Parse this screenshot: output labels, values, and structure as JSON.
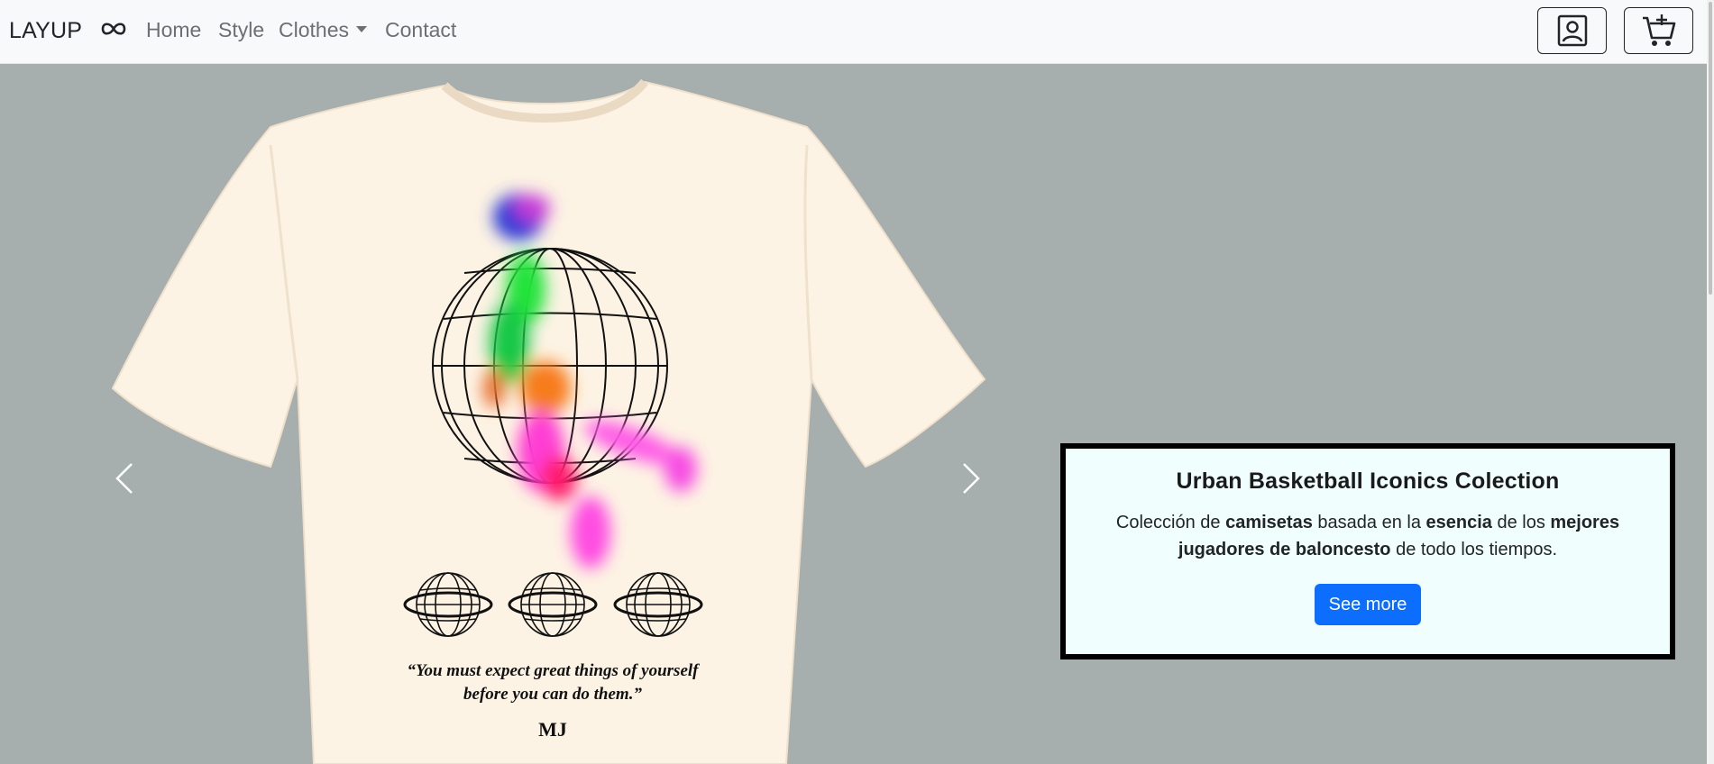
{
  "navbar": {
    "brand": "LAYUP",
    "logo_icon": "infinity-icon",
    "links": {
      "home": "Home",
      "style": "Style",
      "clothes": "Clothes",
      "contact": "Contact"
    },
    "user_icon": "user-profile-icon",
    "cart_icon": "cart-add-icon"
  },
  "carousel": {
    "prev_icon": "chevron-left-icon",
    "next_icon": "chevron-right-icon",
    "slide": {
      "quote_line1": "“You must expect great things of yourself",
      "quote_line2": "before you can do them.”",
      "signature": "MJ"
    },
    "caption": {
      "title": "Urban Basketball Iconics Colection",
      "text_1": "Colección de ",
      "bold_1": "camisetas",
      "text_2": " basada en la ",
      "bold_2": "esencia",
      "text_3": " de los ",
      "bold_3": "mejores jugadores de baloncesto",
      "text_4": " de todo los tiempos.",
      "button": "See more"
    }
  },
  "colors": {
    "background": "#a7aeae",
    "navbar": "#f8f9fa",
    "shirt": "#fdf3e4",
    "caption_bg": "#f1fefe",
    "button": "#0d6efd"
  }
}
